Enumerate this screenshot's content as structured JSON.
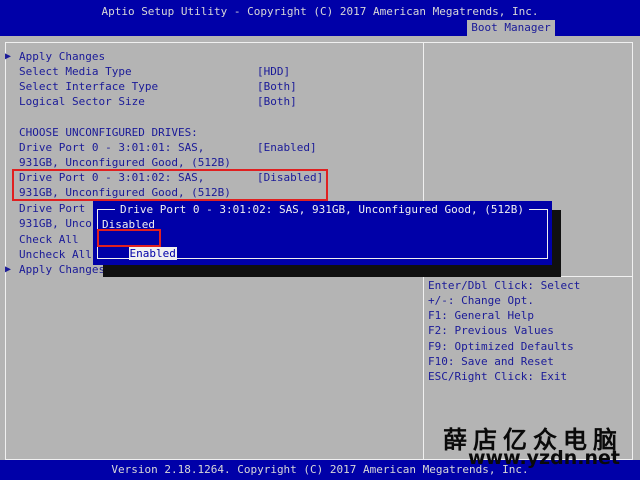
{
  "header": {
    "title": "Aptio Setup Utility - Copyright (C) 2017 American Megatrends, Inc.",
    "active_tab": "Boot Manager"
  },
  "main": {
    "items": [
      {
        "label": "Apply Changes",
        "value": "",
        "selectable": true
      },
      {
        "label": "Select Media Type",
        "value": "[HDD]"
      },
      {
        "label": "Select Interface Type",
        "value": "[Both]"
      },
      {
        "label": "Logical Sector Size",
        "value": "[Both]"
      },
      {
        "label": "CHOOSE UNCONFIGURED DRIVES:",
        "value": ""
      },
      {
        "label": "Drive Port 0 - 3:01:01: SAS,",
        "value": "[Enabled]"
      },
      {
        "label": "931GB, Unconfigured Good, (512B)",
        "value": ""
      },
      {
        "label": "Drive Port 0 - 3:01:02: SAS,",
        "value": "[Disabled]"
      },
      {
        "label": "931GB, Unconfigured Good, (512B)",
        "value": ""
      },
      {
        "label": "Drive Port",
        "value": ""
      },
      {
        "label": "931GB, Unco",
        "value": ""
      },
      {
        "label": "Check All",
        "value": ""
      },
      {
        "label": "Uncheck All",
        "value": ""
      },
      {
        "label": "Apply Changes",
        "value": "",
        "selectable": true
      }
    ]
  },
  "popup": {
    "title": "Drive Port 0 - 3:01:02: SAS, 931GB, Unconfigured Good, (512B)",
    "options": [
      "Disabled",
      "Enabled"
    ],
    "selected": "Enabled"
  },
  "help": {
    "lines": [
      "Enter/Dbl Click: Select",
      "+/-: Change Opt.",
      "F1: General Help",
      "F2: Previous Values",
      "F9: Optimized Defaults",
      "F10: Save and Reset",
      "ESC/Right Click: Exit"
    ]
  },
  "footer": {
    "version": "Version 2.18.1264. Copyright (C) 2017 American Megatrends, Inc."
  },
  "watermark": {
    "text_cn": "薛店亿众电脑",
    "url": "www.yzdn.net"
  },
  "colors": {
    "bar_blue": "#0000a8",
    "panel_gray": "#b4b4b4",
    "text_blue": "#1a1a98",
    "highlight_red": "#e02020"
  },
  "icons": {
    "submenu_arrow": "right-triangle-icon"
  }
}
